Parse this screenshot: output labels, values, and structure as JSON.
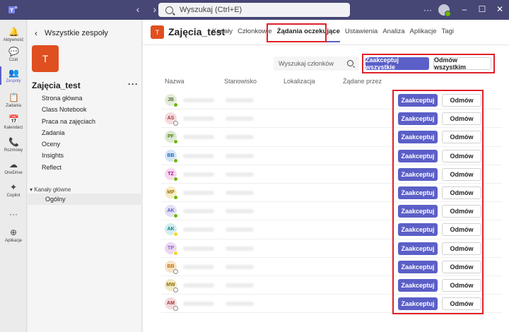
{
  "titlebar": {
    "search_placeholder": "Wyszukaj (Ctrl+E)",
    "back_glyph": "‹",
    "forward_glyph": "›",
    "more_glyph": "···",
    "colors": {
      "bg": "#464775"
    }
  },
  "rail": {
    "items": [
      {
        "label": "Aktywność",
        "icon": "bell-icon",
        "glyph": "🔔"
      },
      {
        "label": "Czat",
        "icon": "chat-icon",
        "glyph": "💬"
      },
      {
        "label": "Zespoły",
        "icon": "teams-icon",
        "glyph": "👥",
        "active": true
      },
      {
        "label": "Zadania",
        "icon": "assignments-icon",
        "glyph": "📋"
      },
      {
        "label": "Kalendarz",
        "icon": "calendar-icon",
        "glyph": "📅"
      },
      {
        "label": "Rozmowy",
        "icon": "phone-icon",
        "glyph": "📞"
      },
      {
        "label": "OneDrive",
        "icon": "cloud-icon",
        "glyph": "☁"
      },
      {
        "label": "Copilot",
        "icon": "copilot-icon",
        "glyph": "✦"
      },
      {
        "label": "",
        "icon": "more-icon",
        "glyph": "···"
      },
      {
        "label": "Aplikacje",
        "icon": "add-app-icon",
        "glyph": "⊕"
      }
    ]
  },
  "teampanel": {
    "back_label": "Wszystkie zespoły",
    "team_initial": "T",
    "team_name": "Zajęcia_test",
    "more": "···",
    "tabs": [
      "Strona główna",
      "Class Notebook",
      "Praca na zajęciach",
      "Zadania",
      "Oceny",
      "Insights",
      "Reflect"
    ],
    "channels_header": "Kanały główne",
    "channels": [
      "Ogólny"
    ]
  },
  "main": {
    "team_initial": "T",
    "title": "Zajęcia_test",
    "tabs": [
      "Kanały",
      "Członkowie",
      "Żądania oczekujące",
      "Ustawienia",
      "Analiza",
      "Aplikacje",
      "Tagi"
    ],
    "active_tab": "Żądania oczekujące",
    "member_search_placeholder": "Wyszukaj członków",
    "accept_all_label": "Zaakceptuj wszystkie",
    "reject_all_label": "Odmów wszystkim",
    "columns": [
      "Nazwa",
      "Stanowisko",
      "Lokalizacja",
      "Żądane przez"
    ],
    "accept_label": "Zaakceptuj",
    "reject_label": "Odmów",
    "requests": [
      {
        "initials": "JB",
        "bg": "#e4ecd9",
        "fg": "#4f6b2f",
        "presence": "available"
      },
      {
        "initials": "AS",
        "bg": "#f3dadd",
        "fg": "#a4373a",
        "presence": "offline"
      },
      {
        "initials": "PF",
        "bg": "#dbe8d2",
        "fg": "#498205",
        "presence": "available"
      },
      {
        "initials": "BB",
        "bg": "#d7e4f5",
        "fg": "#0f6cbd",
        "presence": "available"
      },
      {
        "initials": "TZ",
        "bg": "#f7d9ee",
        "fg": "#b4009e",
        "presence": "available"
      },
      {
        "initials": "MP",
        "bg": "#f7ecc6",
        "fg": "#986f0b",
        "presence": "available"
      },
      {
        "initials": "AK",
        "bg": "#e3dff5",
        "fg": "#5b5fc7",
        "presence": "available"
      },
      {
        "initials": "AK",
        "bg": "#d4ecf0",
        "fg": "#038387",
        "presence": "away"
      },
      {
        "initials": "TP",
        "bg": "#ecd7f2",
        "fg": "#8764b8",
        "presence": "away"
      },
      {
        "initials": "BB",
        "bg": "#f7e3c8",
        "fg": "#c66d00",
        "presence": "offline"
      },
      {
        "initials": "MW",
        "bg": "#f2e9c6",
        "fg": "#8f6f00",
        "presence": "offline"
      },
      {
        "initials": "AM",
        "bg": "#f3dadd",
        "fg": "#a4373a",
        "presence": "offline"
      }
    ]
  }
}
